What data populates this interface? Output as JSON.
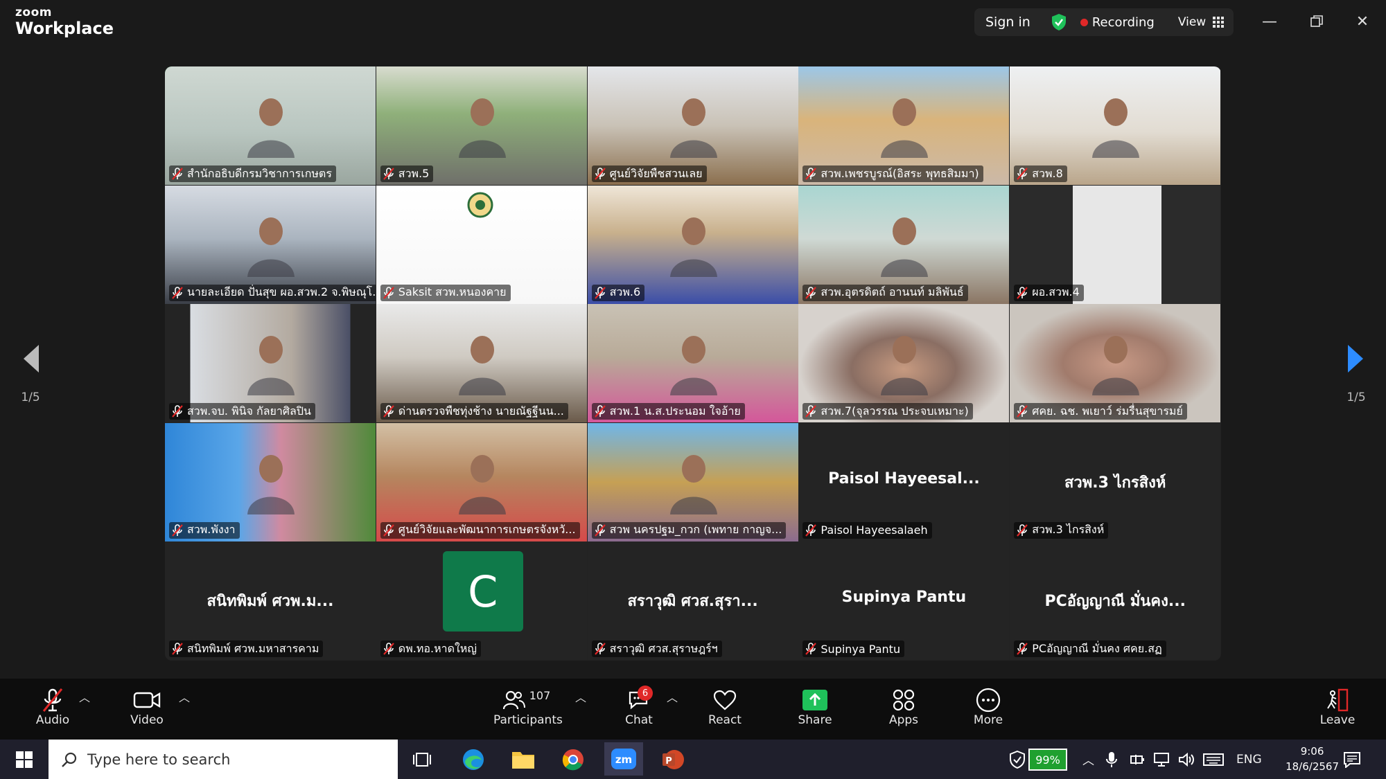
{
  "app": {
    "logo_small": "zoom",
    "logo_big": "Workplace"
  },
  "titlebar": {
    "signin": "Sign in",
    "recording": "Recording",
    "view": "View"
  },
  "tiles": [
    {
      "label": "สำนักอธิบดีกรมวิชาการเกษตร",
      "scene": "office-yellow"
    },
    {
      "label": "สวพ.5",
      "scene": "room-green"
    },
    {
      "label": "ศูนย์วิจัยพืชสวนเลย",
      "scene": "meeting-room"
    },
    {
      "label": "สวพ.เพชรบูรณ์(อิสระ พุทธสิมมา)",
      "scene": "temple"
    },
    {
      "label": "สวพ.8",
      "scene": "room-bright"
    },
    {
      "label": "นายละเอียด ปั่นสุข ผอ.สวพ.2 จ.พิษณุโ...",
      "scene": "conference"
    },
    {
      "label": "Saksit สวพ.หนองคาย",
      "scene": "white-logo"
    },
    {
      "label": "สวพ.6",
      "scene": "blue-shirt"
    },
    {
      "label": "สวพ.อุตรดิตถ์ อานนท์ มลิพันธ์",
      "scene": "office-aqua"
    },
    {
      "label": "ผอ.สวพ.4",
      "scene": "dark-door"
    },
    {
      "label": "สวพ.จบ. พินิจ กัลยาศิลปิน",
      "scene": "office-desk"
    },
    {
      "label": "ด่านตรวจพืชทุ่งช้าง นายณัฐฐีนน...",
      "scene": "uniform"
    },
    {
      "label": "สวพ.1 น.ส.ประนอม ใจอ้าย",
      "scene": "pink-shirt"
    },
    {
      "label": "สวพ.7(จุลวรรณ ประจบเหมาะ)",
      "scene": "face-blur"
    },
    {
      "label": "ศคย. ฉช. พเยาว์ ร่มรื่นสุขารมย์",
      "scene": "face-blur2"
    },
    {
      "label": "สวพ.พังงา",
      "scene": "board-blue"
    },
    {
      "label": "ศูนย์วิจัยและพัฒนาการเกษตรจังหวั...",
      "scene": "red-shirt"
    },
    {
      "label": "สวพ นครปฐม_กวก (เพทาย กาญจ...",
      "scene": "temple2"
    },
    {
      "label": "Paisol Hayeesalaeh",
      "big": "Paisol  Hayeesal...",
      "scene": "none"
    },
    {
      "label": "สวพ.3 ไกรสิงห์",
      "big": "สวพ.3 ไกรสิงห์",
      "scene": "none"
    },
    {
      "label": "สนิทพิมพ์ ศวพ.มหาสารคาม",
      "big": "สนิทพิมพ์ ศวพ.ม...",
      "scene": "none"
    },
    {
      "label": "ดพ.ทอ.หาดใหญ่",
      "avatar": "C",
      "scene": "none"
    },
    {
      "label": "สราวุฒิ ศวส.สุราษฎร์ฯ",
      "big": "สราวุฒิ ศวส.สุรา...",
      "scene": "none"
    },
    {
      "label": "Supinya Pantu",
      "big": "Supinya Pantu",
      "scene": "none"
    },
    {
      "label": "PCอัญญาณี มั่นคง ศคย.สฏ",
      "big": "PCอัญญาณี มั่นคง...",
      "scene": "none"
    }
  ],
  "pager": {
    "left": "1/5",
    "right": "1/5"
  },
  "toolbar": {
    "audio": "Audio",
    "video": "Video",
    "participants": "Participants",
    "participants_count": "107",
    "chat": "Chat",
    "chat_badge": "6",
    "react": "React",
    "share": "Share",
    "apps": "Apps",
    "more": "More",
    "leave": "Leave"
  },
  "taskbar": {
    "search_placeholder": "Type here to search",
    "battery": "99%",
    "lang": "ENG",
    "time": "9:06",
    "date": "18/6/2567"
  },
  "colors": {
    "active_speaker": "#2ecc71",
    "share_green": "#1fc15a",
    "accent_blue": "#2d8cff",
    "record_red": "#e02828"
  }
}
